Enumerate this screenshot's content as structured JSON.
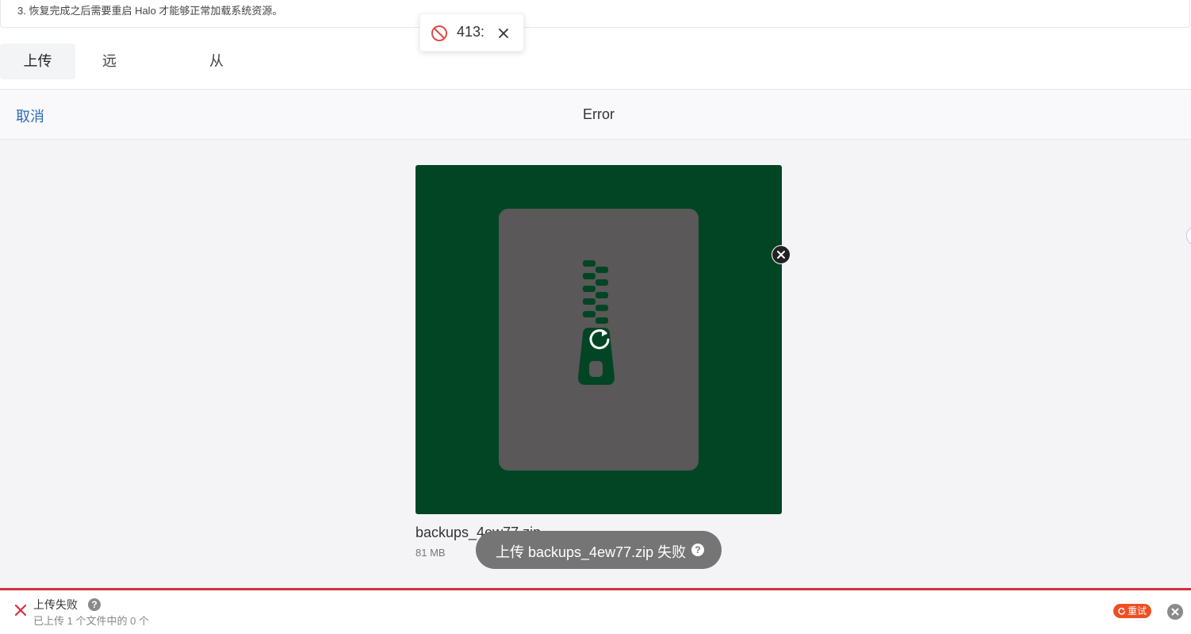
{
  "notice": {
    "text": "3. 恢复完成之后需要重启 Halo 才能够正常加载系统资源。"
  },
  "toast": {
    "icon": "prohibited-icon",
    "text": "413:",
    "close_icon": "close-icon"
  },
  "tabs": [
    {
      "label": "上传",
      "active": true
    },
    {
      "label": "远程恢复",
      "active": false
    },
    {
      "label": "从备份恢复",
      "active": false
    }
  ],
  "uploader": {
    "cancel_label": "取消",
    "header_title": "Error",
    "file": {
      "name": "backups_4ew77.zip",
      "size": "81 MB",
      "icon": "zip-file-icon",
      "preview_color": "#024524"
    },
    "fail_message": "上传 backups_4ew77.zip 失败",
    "help_icon": "help-icon"
  },
  "status_bar": {
    "title": "上传失败",
    "subtitle": "已上传 1 个文件中的 0 个",
    "retry_label": "重试",
    "accent_color": "#d32f3c"
  }
}
